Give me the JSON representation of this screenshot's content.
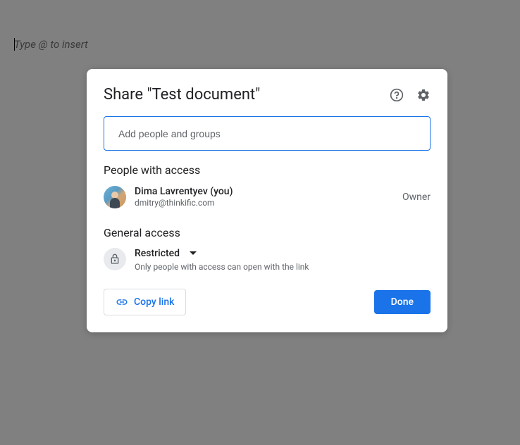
{
  "background": {
    "placeholder": "Type @ to insert"
  },
  "modal": {
    "title": "Share \"Test document\"",
    "input": {
      "placeholder": "Add people and groups"
    },
    "sections": {
      "people_title": "People with access",
      "general_title": "General access"
    },
    "person": {
      "name": "Dima Lavrentyev (you)",
      "email": "dmitry@thinkific.com",
      "role": "Owner"
    },
    "access": {
      "level": "Restricted",
      "description": "Only people with access can open with the link"
    },
    "buttons": {
      "copy_link": "Copy link",
      "done": "Done"
    }
  }
}
